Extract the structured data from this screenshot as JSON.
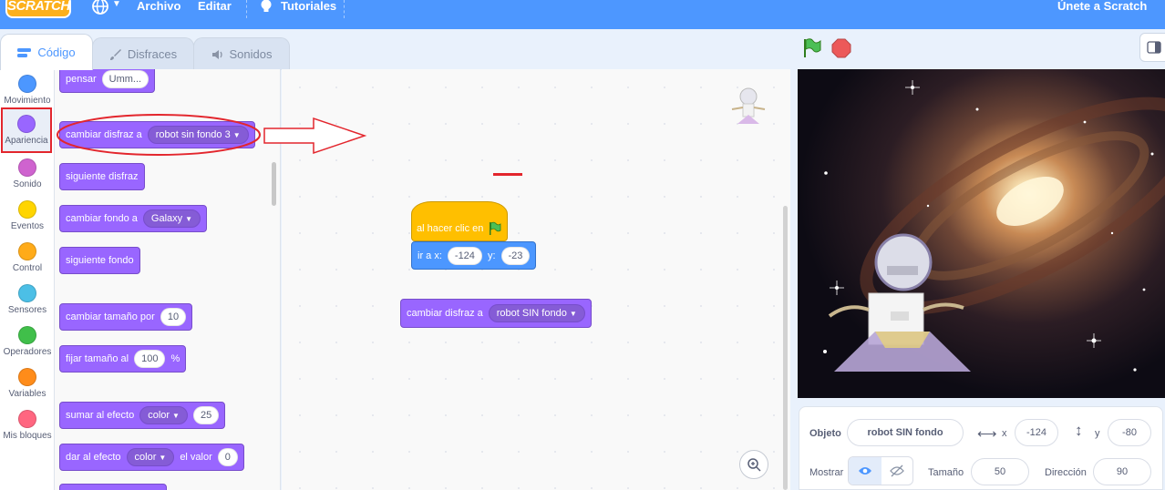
{
  "menubar": {
    "logo": "SCRATCH",
    "archivo": "Archivo",
    "editar": "Editar",
    "tutoriales": "Tutoriales",
    "join": "Únete a Scratch"
  },
  "tabs": {
    "code": "Código",
    "costumes": "Disfraces",
    "sounds": "Sonidos"
  },
  "categories": [
    {
      "label": "Movimiento",
      "color": "#4c97ff"
    },
    {
      "label": "Apariencia",
      "color": "#9966ff"
    },
    {
      "label": "Sonido",
      "color": "#cf63cf"
    },
    {
      "label": "Eventos",
      "color": "#ffd500"
    },
    {
      "label": "Control",
      "color": "#ffab19"
    },
    {
      "label": "Sensores",
      "color": "#4cbfe6"
    },
    {
      "label": "Operadores",
      "color": "#40bf4a"
    },
    {
      "label": "Variables",
      "color": "#ff8c1a"
    },
    {
      "label": "Mis bloques",
      "color": "#ff6680"
    }
  ],
  "palette": {
    "think": {
      "text": "pensar",
      "value": "Umm..."
    },
    "switch_costume": {
      "text": "cambiar disfraz a",
      "value": "robot sin fondo 3"
    },
    "next_costume": {
      "text": "siguiente disfraz"
    },
    "switch_backdrop": {
      "text": "cambiar fondo a",
      "value": "Galaxy"
    },
    "next_backdrop": {
      "text": "siguiente fondo"
    },
    "change_size": {
      "text": "cambiar tamaño por",
      "value": "10"
    },
    "set_size": {
      "text": "fijar tamaño al",
      "value": "100",
      "suffix": "%"
    },
    "change_effect": {
      "text": "sumar al efecto",
      "effect": "color",
      "value": "25"
    },
    "set_effect": {
      "text": "dar al efecto",
      "effect": "color",
      "mid": "el valor",
      "value": "0"
    }
  },
  "script": {
    "hat": "al hacer clic en",
    "goto": {
      "text": "ir a x:",
      "x": "-124",
      "ylabel": "y:",
      "y": "-23"
    },
    "costume": {
      "text": "cambiar disfraz a",
      "value": "robot SIN fondo"
    }
  },
  "sprite_info": {
    "object_label": "Objeto",
    "name": "robot SIN fondo",
    "x_label": "x",
    "x": "-124",
    "y_label": "y",
    "y": "-80",
    "show_label": "Mostrar",
    "size_label": "Tamaño",
    "size": "50",
    "direction_label": "Dirección",
    "direction": "90"
  },
  "colors": {
    "menubar": "#4d97ff",
    "looks": "#9966ff",
    "events": "#ffbf00",
    "motion": "#4c97ff",
    "annotation": "#e3262d"
  }
}
